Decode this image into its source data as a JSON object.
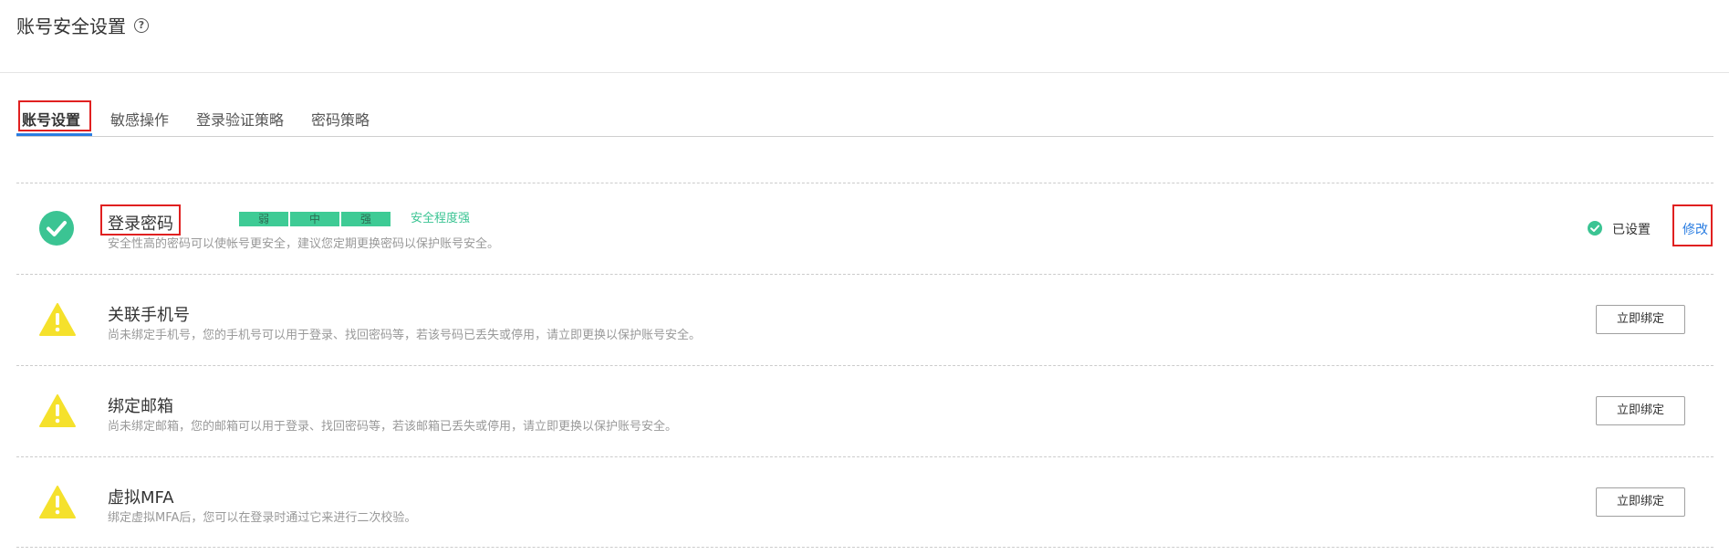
{
  "page": {
    "title": "账号安全设置",
    "help_icon": "question-circle-icon"
  },
  "tabs": [
    {
      "label": "账号设置",
      "active": true
    },
    {
      "label": "敏感操作",
      "active": false
    },
    {
      "label": "登录验证策略",
      "active": false
    },
    {
      "label": "密码策略",
      "active": false
    }
  ],
  "rows": [
    {
      "icon": "check-circle-icon",
      "title": "登录密码",
      "description": "安全性高的密码可以使帐号更安全，建议您定期更换密码以保护账号安全。",
      "strength": {
        "segments": [
          "弱",
          "中",
          "强"
        ],
        "label": "安全程度强"
      },
      "status_icon": "check-circle-small-icon",
      "status_text": "已设置",
      "action_label": "修改"
    },
    {
      "icon": "warning-triangle-icon",
      "title": "关联手机号",
      "description": "尚未绑定手机号，您的手机号可以用于登录、找回密码等，若该号码已丢失或停用，请立即更换以保护账号安全。",
      "action_label": "立即绑定"
    },
    {
      "icon": "warning-triangle-icon",
      "title": "绑定邮箱",
      "description": "尚未绑定邮箱，您的邮箱可以用于登录、找回密码等，若该邮箱已丢失或停用，请立即更换以保护账号安全。",
      "action_label": "立即绑定"
    },
    {
      "icon": "warning-triangle-icon",
      "title": "虚拟MFA",
      "description": "绑定虚拟MFA后，您可以在登录时通过它来进行二次校验。",
      "action_label": "立即绑定"
    }
  ],
  "colors": {
    "accent": "#2a7de1",
    "success": "#3bc493",
    "warning": "#f5e12c",
    "highlight": "#e02020"
  }
}
